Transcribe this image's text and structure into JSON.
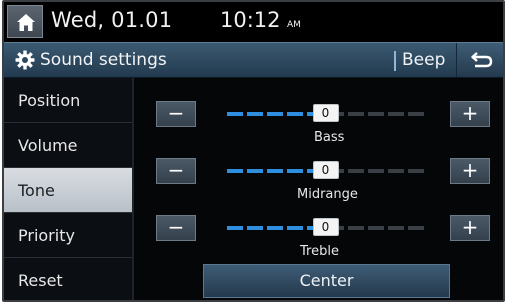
{
  "status_bar": {
    "home_icon": "home-icon",
    "date": "Wed, 01.01",
    "time": "10:12",
    "ampm": "AM"
  },
  "title_bar": {
    "icon": "gear-icon",
    "title": "Sound settings",
    "beep_label": "Beep",
    "back_icon": "back-arrow-icon"
  },
  "sidebar": {
    "items": [
      {
        "label": "Position",
        "active": false
      },
      {
        "label": "Volume",
        "active": false
      },
      {
        "label": "Tone",
        "active": true
      },
      {
        "label": "Priority",
        "active": false
      },
      {
        "label": "Reset",
        "active": false
      }
    ]
  },
  "tone": {
    "minus_label": "−",
    "plus_label": "+",
    "sliders": [
      {
        "name": "Bass",
        "value": "0",
        "level": 0.5
      },
      {
        "name": "Midrange",
        "value": "0",
        "level": 0.5
      },
      {
        "name": "Treble",
        "value": "0",
        "level": 0.5
      }
    ],
    "center_label": "Center"
  },
  "colors": {
    "track_active": "#2f8ee0",
    "track_inactive": "#3a3f45",
    "accent": "#2f8ee0"
  }
}
